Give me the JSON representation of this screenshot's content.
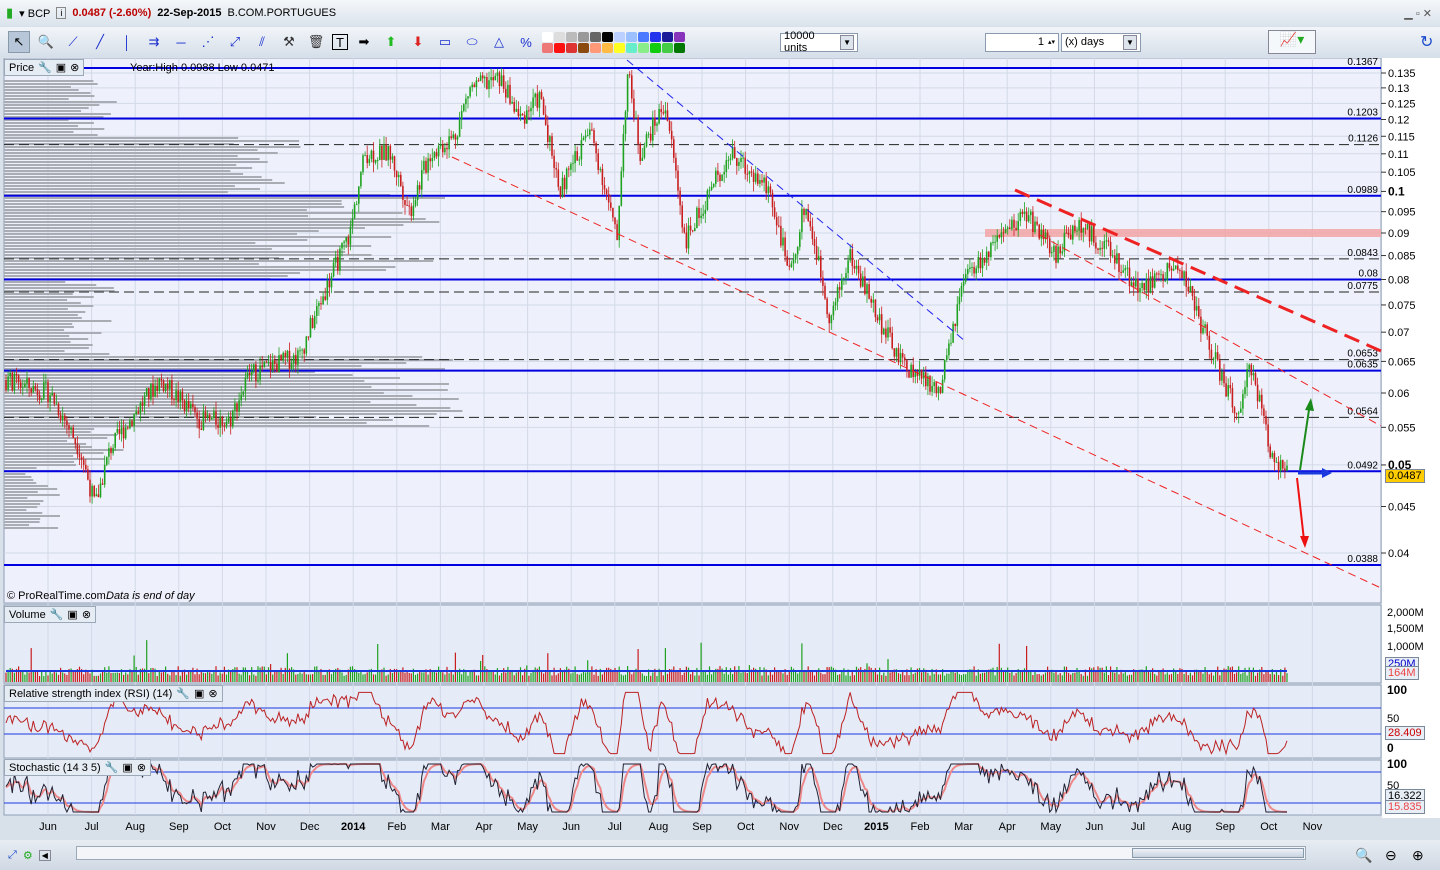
{
  "title": {
    "symbol": "BCP",
    "price": "0.0487 (-2.60%)",
    "date": "22-Sep-2015",
    "name": "B.COM.PORTUGUES"
  },
  "toolbar": {
    "units": "10000 units",
    "period_value": "1",
    "period_unit": "(x) days"
  },
  "price_pane": {
    "label": "Price",
    "year_info": "Year:High 0.0988 Low 0.0471",
    "copyright": "© ProRealTime.com",
    "note": "Data is end of day",
    "last_price": "0.0487"
  },
  "volume_pane": {
    "label": "Volume",
    "ticks": [
      "2,000M",
      "1,500M",
      "1,000M"
    ],
    "avg_tag": "250M",
    "last_tag": "164M"
  },
  "rsi_pane": {
    "label": "Relative strength index (RSI) (14)",
    "ticks": [
      "100",
      "50",
      "0"
    ],
    "value": "28.409"
  },
  "stoch_pane": {
    "label": "Stochastic (14 3 5)",
    "ticks": [
      "100",
      "50"
    ],
    "k": "16.322",
    "d": "15.835"
  },
  "colors": {
    "up": "#1fa21f",
    "down": "#c81e1e",
    "level": "#0000e0",
    "accent": "#ffcc00"
  },
  "chart_data": {
    "type": "candlestick",
    "y_scale": "log",
    "ylim": [
      0.035,
      0.14
    ],
    "y_ticks": [
      "0.135",
      "0.13",
      "0.125",
      "0.12",
      "0.115",
      "0.11",
      "0.105",
      "0.1",
      "0.095",
      "0.09",
      "0.085",
      "0.08",
      "0.075",
      "0.07",
      "0.065",
      "0.06",
      "0.055",
      "0.05",
      "0.045",
      "0.04"
    ],
    "y_tick_values": [
      0.135,
      0.13,
      0.125,
      0.12,
      0.115,
      0.11,
      0.105,
      0.1,
      0.095,
      0.09,
      0.085,
      0.08,
      0.075,
      0.07,
      0.065,
      0.06,
      0.055,
      0.05,
      0.045,
      0.04
    ],
    "x_ticks": [
      "Jun",
      "Jul",
      "Aug",
      "Sep",
      "Oct",
      "Nov",
      "Dec",
      "2014",
      "Feb",
      "Mar",
      "Apr",
      "May",
      "Jun",
      "Jul",
      "Aug",
      "Sep",
      "Oct",
      "Nov",
      "Dec",
      "2015",
      "Feb",
      "Mar",
      "Apr",
      "May",
      "Jun",
      "Jul",
      "Aug",
      "Sep",
      "Oct",
      "Nov"
    ],
    "x_unit": "months since Jun 2013",
    "close_path": [
      [
        -1.0,
        0.062
      ],
      [
        0.05,
        0.06
      ],
      [
        0.73,
        0.052
      ],
      [
        1.08,
        0.045
      ],
      [
        1.42,
        0.052
      ],
      [
        2.57,
        0.062
      ],
      [
        3.49,
        0.056
      ],
      [
        4.17,
        0.056
      ],
      [
        4.63,
        0.063
      ],
      [
        5.78,
        0.066
      ],
      [
        6.47,
        0.08
      ],
      [
        6.93,
        0.09
      ],
      [
        7.27,
        0.11
      ],
      [
        7.84,
        0.11
      ],
      [
        8.3,
        0.095
      ],
      [
        8.76,
        0.11
      ],
      [
        9.33,
        0.115
      ],
      [
        9.68,
        0.13
      ],
      [
        10.37,
        0.133
      ],
      [
        10.83,
        0.12
      ],
      [
        11.28,
        0.127
      ],
      [
        11.74,
        0.1
      ],
      [
        12.43,
        0.117
      ],
      [
        13.05,
        0.088
      ],
      [
        13.3,
        0.135
      ],
      [
        13.58,
        0.11
      ],
      [
        14.15,
        0.125
      ],
      [
        14.61,
        0.088
      ],
      [
        14.95,
        0.095
      ],
      [
        15.64,
        0.11
      ],
      [
        16.56,
        0.1
      ],
      [
        17.02,
        0.08
      ],
      [
        17.36,
        0.097
      ],
      [
        17.94,
        0.072
      ],
      [
        18.39,
        0.085
      ],
      [
        19.08,
        0.072
      ],
      [
        19.54,
        0.065
      ],
      [
        20.46,
        0.06
      ],
      [
        21.03,
        0.08
      ],
      [
        21.83,
        0.088
      ],
      [
        22.41,
        0.095
      ],
      [
        23.1,
        0.085
      ],
      [
        23.55,
        0.092
      ],
      [
        24.13,
        0.088
      ],
      [
        25.05,
        0.078
      ],
      [
        25.96,
        0.083
      ],
      [
        26.42,
        0.072
      ],
      [
        26.88,
        0.063
      ],
      [
        27.34,
        0.056
      ],
      [
        27.57,
        0.065
      ],
      [
        28.03,
        0.052
      ],
      [
        28.42,
        0.0487
      ]
    ],
    "solid_levels": [
      {
        "value": 0.1367,
        "label": "0.1367"
      },
      {
        "value": 0.1203,
        "label": "0.1203"
      },
      {
        "value": 0.0989,
        "label": "0.0989"
      },
      {
        "value": 0.08,
        "label": "0.08"
      },
      {
        "value": 0.0635,
        "label": "0.0635"
      },
      {
        "value": 0.0492,
        "label": "0.0492"
      },
      {
        "value": 0.0388,
        "label": "0.0388"
      }
    ],
    "dashed_levels": [
      {
        "value": 0.1126,
        "label": "0.1126"
      },
      {
        "value": 0.0843,
        "label": "0.0843"
      },
      {
        "value": 0.0775,
        "label": "0.0775"
      },
      {
        "value": 0.0653,
        "label": "0.0653"
      },
      {
        "value": 0.0564,
        "label": "0.0564"
      }
    ],
    "resistance_band": 0.09
  }
}
